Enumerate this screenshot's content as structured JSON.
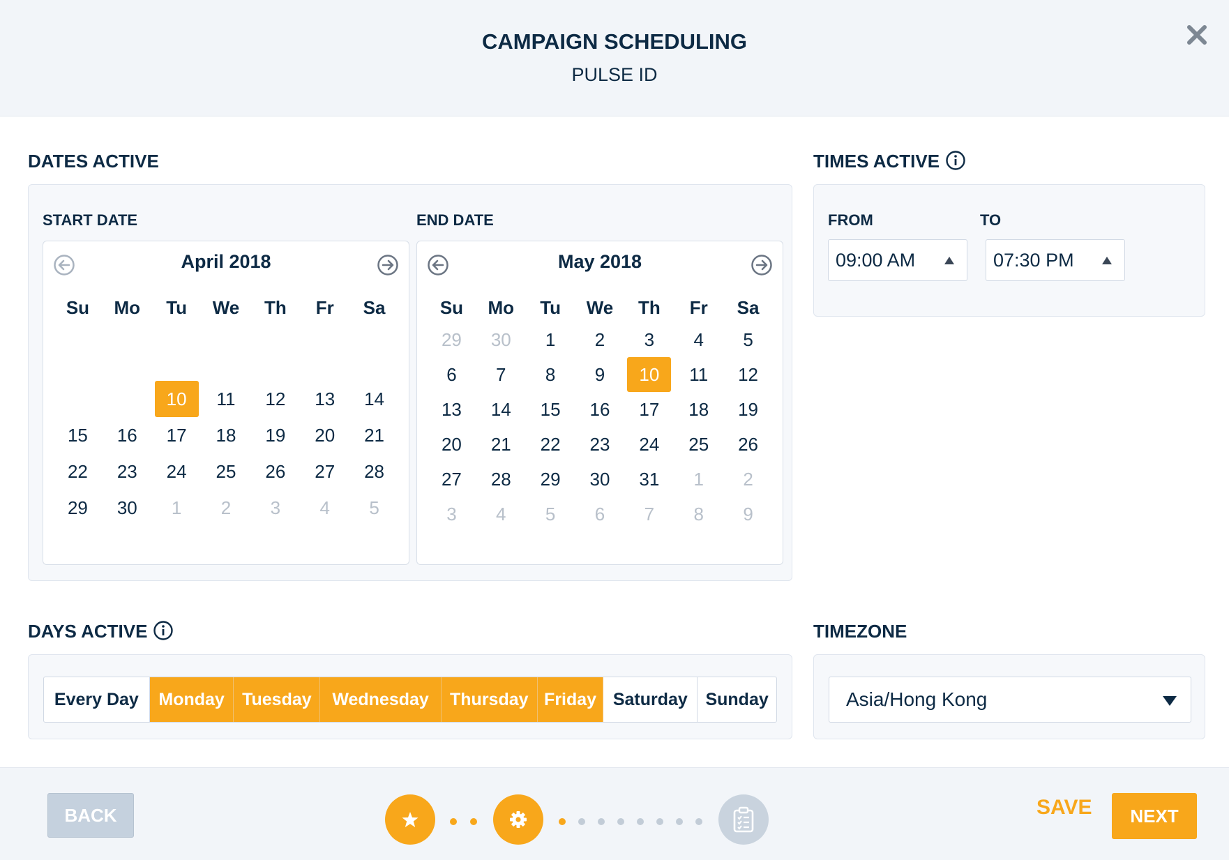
{
  "header": {
    "title": "CAMPAIGN SCHEDULING",
    "subtitle": "PULSE ID"
  },
  "dates_active": {
    "label": "DATES ACTIVE",
    "start": {
      "label": "START DATE",
      "month": "April 2018",
      "weekdays": [
        "Su",
        "Mo",
        "Tu",
        "We",
        "Th",
        "Fr",
        "Sa"
      ],
      "rows": [
        [
          {
            "t": "",
            "s": "empty"
          },
          {
            "t": "",
            "s": "empty"
          },
          {
            "t": "10",
            "s": "selected"
          },
          {
            "t": "11",
            "s": ""
          },
          {
            "t": "12",
            "s": ""
          },
          {
            "t": "13",
            "s": ""
          },
          {
            "t": "14",
            "s": ""
          }
        ],
        [
          {
            "t": "15",
            "s": ""
          },
          {
            "t": "16",
            "s": ""
          },
          {
            "t": "17",
            "s": ""
          },
          {
            "t": "18",
            "s": ""
          },
          {
            "t": "19",
            "s": ""
          },
          {
            "t": "20",
            "s": ""
          },
          {
            "t": "21",
            "s": ""
          }
        ],
        [
          {
            "t": "22",
            "s": ""
          },
          {
            "t": "23",
            "s": ""
          },
          {
            "t": "24",
            "s": ""
          },
          {
            "t": "25",
            "s": ""
          },
          {
            "t": "26",
            "s": ""
          },
          {
            "t": "27",
            "s": ""
          },
          {
            "t": "28",
            "s": ""
          }
        ],
        [
          {
            "t": "29",
            "s": ""
          },
          {
            "t": "30",
            "s": ""
          },
          {
            "t": "1",
            "s": "muted"
          },
          {
            "t": "2",
            "s": "muted"
          },
          {
            "t": "3",
            "s": "muted"
          },
          {
            "t": "4",
            "s": "muted"
          },
          {
            "t": "5",
            "s": "muted"
          }
        ]
      ]
    },
    "end": {
      "label": "END DATE",
      "month": "May 2018",
      "weekdays": [
        "Su",
        "Mo",
        "Tu",
        "We",
        "Th",
        "Fr",
        "Sa"
      ],
      "rows": [
        [
          {
            "t": "29",
            "s": "muted"
          },
          {
            "t": "30",
            "s": "muted"
          },
          {
            "t": "1",
            "s": ""
          },
          {
            "t": "2",
            "s": ""
          },
          {
            "t": "3",
            "s": ""
          },
          {
            "t": "4",
            "s": ""
          },
          {
            "t": "5",
            "s": ""
          }
        ],
        [
          {
            "t": "6",
            "s": ""
          },
          {
            "t": "7",
            "s": ""
          },
          {
            "t": "8",
            "s": ""
          },
          {
            "t": "9",
            "s": ""
          },
          {
            "t": "10",
            "s": "selected"
          },
          {
            "t": "11",
            "s": ""
          },
          {
            "t": "12",
            "s": ""
          }
        ],
        [
          {
            "t": "13",
            "s": ""
          },
          {
            "t": "14",
            "s": ""
          },
          {
            "t": "15",
            "s": ""
          },
          {
            "t": "16",
            "s": ""
          },
          {
            "t": "17",
            "s": ""
          },
          {
            "t": "18",
            "s": ""
          },
          {
            "t": "19",
            "s": ""
          }
        ],
        [
          {
            "t": "20",
            "s": ""
          },
          {
            "t": "21",
            "s": ""
          },
          {
            "t": "22",
            "s": ""
          },
          {
            "t": "23",
            "s": ""
          },
          {
            "t": "24",
            "s": ""
          },
          {
            "t": "25",
            "s": ""
          },
          {
            "t": "26",
            "s": ""
          }
        ],
        [
          {
            "t": "27",
            "s": ""
          },
          {
            "t": "28",
            "s": ""
          },
          {
            "t": "29",
            "s": ""
          },
          {
            "t": "30",
            "s": ""
          },
          {
            "t": "31",
            "s": ""
          },
          {
            "t": "1",
            "s": "muted"
          },
          {
            "t": "2",
            "s": "muted"
          }
        ],
        [
          {
            "t": "3",
            "s": "muted"
          },
          {
            "t": "4",
            "s": "muted"
          },
          {
            "t": "5",
            "s": "muted"
          },
          {
            "t": "6",
            "s": "muted"
          },
          {
            "t": "7",
            "s": "muted"
          },
          {
            "t": "8",
            "s": "muted"
          },
          {
            "t": "9",
            "s": "muted"
          }
        ]
      ]
    }
  },
  "times_active": {
    "label": "TIMES ACTIVE",
    "from_label": "FROM",
    "to_label": "TO",
    "from_value": "09:00 AM",
    "to_value": "07:30 PM"
  },
  "days_active": {
    "label": "DAYS ACTIVE",
    "options": [
      {
        "label": "Every Day",
        "active": false
      },
      {
        "label": "Monday",
        "active": true
      },
      {
        "label": "Tuesday",
        "active": true
      },
      {
        "label": "Wednesday",
        "active": true
      },
      {
        "label": "Thursday",
        "active": true
      },
      {
        "label": "Friday",
        "active": true
      },
      {
        "label": "Saturday",
        "active": false
      },
      {
        "label": "Sunday",
        "active": false
      }
    ]
  },
  "timezone": {
    "label": "TIMEZONE",
    "value": "Asia/Hong Kong"
  },
  "footer": {
    "back_label": "BACK",
    "save_label": "SAVE",
    "next_label": "NEXT",
    "steps": [
      {
        "icon": "star-icon",
        "state": "done"
      },
      {
        "icon": "gear-icon",
        "state": "done"
      },
      {
        "icon": "clipboard-icon",
        "state": "todo"
      }
    ]
  },
  "colors": {
    "accent": "#f8a71b",
    "text": "#0d2a44",
    "muted": "#b8c0ca",
    "panel": "#f6f8fb",
    "header_bg": "#f2f5f9"
  }
}
